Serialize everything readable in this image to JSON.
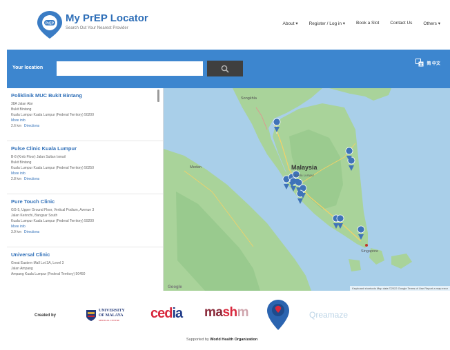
{
  "header": {
    "title": "My PrEP Locator",
    "subtitle": "Search Out Your Nearest Provider",
    "nav": [
      "About ▾",
      "Register / Log in ▾",
      "Book a Slot",
      "Contact Us",
      "Others ▾"
    ]
  },
  "search": {
    "label": "Your location",
    "value": "",
    "placeholder": "",
    "language": "简 中文"
  },
  "clinics": [
    {
      "name": "Poliklinik MUC Bukit Bintang",
      "address": [
        "38A Jalan Alor",
        "Bukit Bintang",
        "Kuala Lumpur Kuala Lumpur (Federal Territory) 50200"
      ],
      "more": "More info",
      "distance": "2.6 km",
      "directions": "Directions"
    },
    {
      "name": "Pulse Clinic Kuala Lumpur",
      "address": [
        "B-8 (Kmb Floor) Jalan Sultan Ismail",
        "Bukit Bintang",
        "Kuala Lumpur Kuala Lumpur (Federal Territory) 50250"
      ],
      "more": "More info",
      "distance": "2.8 km",
      "directions": "Directions"
    },
    {
      "name": "Pure Touch Clinic",
      "address": [
        "GG-5, Upper Ground Floor, Vertical Podium, Avenue 3",
        "Jalan Kerinchi, Bangsar South",
        "Kuala Lumpur Kuala Lumpur (Federal Territory) 59200"
      ],
      "more": "More info",
      "distance": "3.9 km",
      "directions": "Directions"
    },
    {
      "name": "Universal Clinic",
      "address": [
        "Great Eastern Mall Lot 3A, Level 3",
        "Jalan Ampang",
        "Ampang Kuala Lumpur (Federal Territory) 50450"
      ],
      "more": "",
      "distance": "",
      "directions": ""
    }
  ],
  "map": {
    "country_label": "Malaysia",
    "place_labels": [
      "Songkhla",
      "Medan",
      "Singapore",
      "Kuala Lumpur"
    ],
    "google": "Google",
    "attribution": "Keyboard shortcuts   Map data ©2022 Google   Terms of Use   Report a map error",
    "colors": {
      "water": "#a9cfe9",
      "land": "#a9d39a",
      "marker": "#3f73b8"
    }
  },
  "footer": {
    "created_by": "Created by",
    "um_line1": "UNIVERSITY",
    "um_line2": "OF MALAYA",
    "um_line3": "MEDICAL CENTRE",
    "cedia_a": "ced",
    "cedia_b": "ia",
    "mashm_a": "ma",
    "mashm_b": "sh",
    "mashm_c": "m",
    "qreamaze": "Qreamaze",
    "supported_prefix": "Supported by",
    "supported_org": "World Health Organization"
  }
}
